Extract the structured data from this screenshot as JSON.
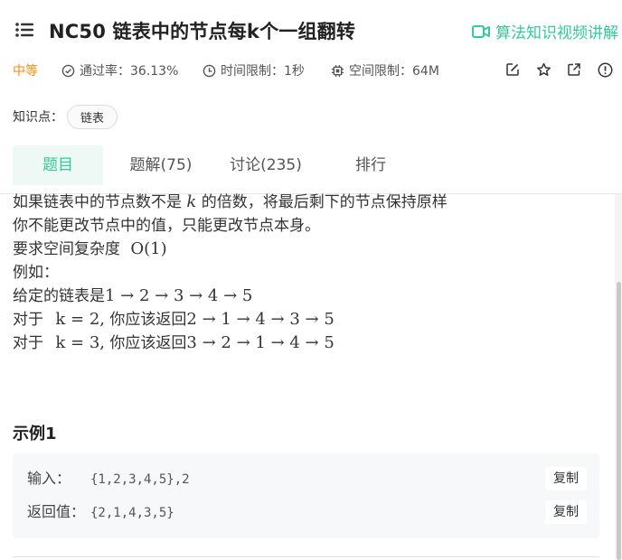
{
  "header": {
    "title": "NC50  链表中的节点每k个一组翻转",
    "video_link": "算法知识视频讲解",
    "difficulty": "中等",
    "pass_rate": "通过率：36.13%",
    "time_limit": "时间限制：1秒",
    "space_limit": "空间限制：64M",
    "knowledge_label": "知识点：",
    "knowledge_tag": "链表",
    "accent_color": "#32ca99",
    "difficulty_color": "#ff8a00"
  },
  "tabs": [
    {
      "label": "题目",
      "active": true
    },
    {
      "label": "题解(75)",
      "active": false
    },
    {
      "label": "讨论(235)",
      "active": false
    },
    {
      "label": "排行",
      "active": false
    }
  ],
  "description": {
    "line1_a": "如果链表中的节点数不是",
    "line1_k": "k",
    "line1_b": "的倍数，将最后剩下的节点保持原样",
    "line2": "你不能更改节点中的值，只能更改节点本身。",
    "line3_a": "要求空间复杂度",
    "line3_math": "O(1)",
    "line4": "例如：",
    "line5_a": "给定的链表是",
    "line5_math": "1 → 2 → 3 → 4 → 5",
    "line6_a": "对于",
    "line6_k": "k = 2,",
    "line6_b": "你应该返回",
    "line6_math": "2 → 1 → 4 → 3 → 5",
    "line7_a": "对于",
    "line7_k": "k = 3,",
    "line7_b": "你应该返回",
    "line7_math": "3 → 2 → 1 → 4 → 5"
  },
  "example": {
    "title": "示例1",
    "input_label": "输入：",
    "input_value": "{1,2,3,4,5},2",
    "output_label": "返回值：",
    "output_value": "{2,1,4,3,5}",
    "copy_label": "复制"
  },
  "icons": [
    "menu-icon",
    "video-icon",
    "check-circle-icon",
    "clock-icon",
    "chip-icon",
    "edit-icon",
    "star-icon",
    "share-icon",
    "info-icon"
  ]
}
